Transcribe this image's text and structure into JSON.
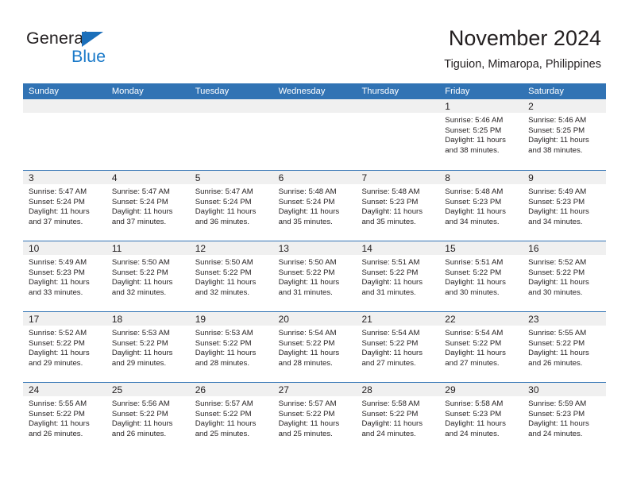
{
  "brand": {
    "name_part1": "General",
    "name_part2": "Blue",
    "triangle_color": "#1b6fba",
    "blue_color": "#1b7ac9",
    "dark_color": "#231f20"
  },
  "header": {
    "title": "November 2024",
    "subtitle": "Tiguion, Mimaropa, Philippines",
    "accent_color": "#3173b4",
    "band_color": "#f0f0f0"
  },
  "weekdays": [
    "Sunday",
    "Monday",
    "Tuesday",
    "Wednesday",
    "Thursday",
    "Friday",
    "Saturday"
  ],
  "weeks": [
    [
      {
        "day": "",
        "sunrise": "",
        "sunset": "",
        "daylight1": "",
        "daylight2": "",
        "empty": true
      },
      {
        "day": "",
        "sunrise": "",
        "sunset": "",
        "daylight1": "",
        "daylight2": "",
        "empty": true
      },
      {
        "day": "",
        "sunrise": "",
        "sunset": "",
        "daylight1": "",
        "daylight2": "",
        "empty": true
      },
      {
        "day": "",
        "sunrise": "",
        "sunset": "",
        "daylight1": "",
        "daylight2": "",
        "empty": true
      },
      {
        "day": "",
        "sunrise": "",
        "sunset": "",
        "daylight1": "",
        "daylight2": "",
        "empty": true
      },
      {
        "day": "1",
        "sunrise": "Sunrise: 5:46 AM",
        "sunset": "Sunset: 5:25 PM",
        "daylight1": "Daylight: 11 hours",
        "daylight2": "and 38 minutes.",
        "empty": false
      },
      {
        "day": "2",
        "sunrise": "Sunrise: 5:46 AM",
        "sunset": "Sunset: 5:25 PM",
        "daylight1": "Daylight: 11 hours",
        "daylight2": "and 38 minutes.",
        "empty": false
      }
    ],
    [
      {
        "day": "3",
        "sunrise": "Sunrise: 5:47 AM",
        "sunset": "Sunset: 5:24 PM",
        "daylight1": "Daylight: 11 hours",
        "daylight2": "and 37 minutes.",
        "empty": false
      },
      {
        "day": "4",
        "sunrise": "Sunrise: 5:47 AM",
        "sunset": "Sunset: 5:24 PM",
        "daylight1": "Daylight: 11 hours",
        "daylight2": "and 37 minutes.",
        "empty": false
      },
      {
        "day": "5",
        "sunrise": "Sunrise: 5:47 AM",
        "sunset": "Sunset: 5:24 PM",
        "daylight1": "Daylight: 11 hours",
        "daylight2": "and 36 minutes.",
        "empty": false
      },
      {
        "day": "6",
        "sunrise": "Sunrise: 5:48 AM",
        "sunset": "Sunset: 5:24 PM",
        "daylight1": "Daylight: 11 hours",
        "daylight2": "and 35 minutes.",
        "empty": false
      },
      {
        "day": "7",
        "sunrise": "Sunrise: 5:48 AM",
        "sunset": "Sunset: 5:23 PM",
        "daylight1": "Daylight: 11 hours",
        "daylight2": "and 35 minutes.",
        "empty": false
      },
      {
        "day": "8",
        "sunrise": "Sunrise: 5:48 AM",
        "sunset": "Sunset: 5:23 PM",
        "daylight1": "Daylight: 11 hours",
        "daylight2": "and 34 minutes.",
        "empty": false
      },
      {
        "day": "9",
        "sunrise": "Sunrise: 5:49 AM",
        "sunset": "Sunset: 5:23 PM",
        "daylight1": "Daylight: 11 hours",
        "daylight2": "and 34 minutes.",
        "empty": false
      }
    ],
    [
      {
        "day": "10",
        "sunrise": "Sunrise: 5:49 AM",
        "sunset": "Sunset: 5:23 PM",
        "daylight1": "Daylight: 11 hours",
        "daylight2": "and 33 minutes.",
        "empty": false
      },
      {
        "day": "11",
        "sunrise": "Sunrise: 5:50 AM",
        "sunset": "Sunset: 5:22 PM",
        "daylight1": "Daylight: 11 hours",
        "daylight2": "and 32 minutes.",
        "empty": false
      },
      {
        "day": "12",
        "sunrise": "Sunrise: 5:50 AM",
        "sunset": "Sunset: 5:22 PM",
        "daylight1": "Daylight: 11 hours",
        "daylight2": "and 32 minutes.",
        "empty": false
      },
      {
        "day": "13",
        "sunrise": "Sunrise: 5:50 AM",
        "sunset": "Sunset: 5:22 PM",
        "daylight1": "Daylight: 11 hours",
        "daylight2": "and 31 minutes.",
        "empty": false
      },
      {
        "day": "14",
        "sunrise": "Sunrise: 5:51 AM",
        "sunset": "Sunset: 5:22 PM",
        "daylight1": "Daylight: 11 hours",
        "daylight2": "and 31 minutes.",
        "empty": false
      },
      {
        "day": "15",
        "sunrise": "Sunrise: 5:51 AM",
        "sunset": "Sunset: 5:22 PM",
        "daylight1": "Daylight: 11 hours",
        "daylight2": "and 30 minutes.",
        "empty": false
      },
      {
        "day": "16",
        "sunrise": "Sunrise: 5:52 AM",
        "sunset": "Sunset: 5:22 PM",
        "daylight1": "Daylight: 11 hours",
        "daylight2": "and 30 minutes.",
        "empty": false
      }
    ],
    [
      {
        "day": "17",
        "sunrise": "Sunrise: 5:52 AM",
        "sunset": "Sunset: 5:22 PM",
        "daylight1": "Daylight: 11 hours",
        "daylight2": "and 29 minutes.",
        "empty": false
      },
      {
        "day": "18",
        "sunrise": "Sunrise: 5:53 AM",
        "sunset": "Sunset: 5:22 PM",
        "daylight1": "Daylight: 11 hours",
        "daylight2": "and 29 minutes.",
        "empty": false
      },
      {
        "day": "19",
        "sunrise": "Sunrise: 5:53 AM",
        "sunset": "Sunset: 5:22 PM",
        "daylight1": "Daylight: 11 hours",
        "daylight2": "and 28 minutes.",
        "empty": false
      },
      {
        "day": "20",
        "sunrise": "Sunrise: 5:54 AM",
        "sunset": "Sunset: 5:22 PM",
        "daylight1": "Daylight: 11 hours",
        "daylight2": "and 28 minutes.",
        "empty": false
      },
      {
        "day": "21",
        "sunrise": "Sunrise: 5:54 AM",
        "sunset": "Sunset: 5:22 PM",
        "daylight1": "Daylight: 11 hours",
        "daylight2": "and 27 minutes.",
        "empty": false
      },
      {
        "day": "22",
        "sunrise": "Sunrise: 5:54 AM",
        "sunset": "Sunset: 5:22 PM",
        "daylight1": "Daylight: 11 hours",
        "daylight2": "and 27 minutes.",
        "empty": false
      },
      {
        "day": "23",
        "sunrise": "Sunrise: 5:55 AM",
        "sunset": "Sunset: 5:22 PM",
        "daylight1": "Daylight: 11 hours",
        "daylight2": "and 26 minutes.",
        "empty": false
      }
    ],
    [
      {
        "day": "24",
        "sunrise": "Sunrise: 5:55 AM",
        "sunset": "Sunset: 5:22 PM",
        "daylight1": "Daylight: 11 hours",
        "daylight2": "and 26 minutes.",
        "empty": false
      },
      {
        "day": "25",
        "sunrise": "Sunrise: 5:56 AM",
        "sunset": "Sunset: 5:22 PM",
        "daylight1": "Daylight: 11 hours",
        "daylight2": "and 26 minutes.",
        "empty": false
      },
      {
        "day": "26",
        "sunrise": "Sunrise: 5:57 AM",
        "sunset": "Sunset: 5:22 PM",
        "daylight1": "Daylight: 11 hours",
        "daylight2": "and 25 minutes.",
        "empty": false
      },
      {
        "day": "27",
        "sunrise": "Sunrise: 5:57 AM",
        "sunset": "Sunset: 5:22 PM",
        "daylight1": "Daylight: 11 hours",
        "daylight2": "and 25 minutes.",
        "empty": false
      },
      {
        "day": "28",
        "sunrise": "Sunrise: 5:58 AM",
        "sunset": "Sunset: 5:22 PM",
        "daylight1": "Daylight: 11 hours",
        "daylight2": "and 24 minutes.",
        "empty": false
      },
      {
        "day": "29",
        "sunrise": "Sunrise: 5:58 AM",
        "sunset": "Sunset: 5:23 PM",
        "daylight1": "Daylight: 11 hours",
        "daylight2": "and 24 minutes.",
        "empty": false
      },
      {
        "day": "30",
        "sunrise": "Sunrise: 5:59 AM",
        "sunset": "Sunset: 5:23 PM",
        "daylight1": "Daylight: 11 hours",
        "daylight2": "and 24 minutes.",
        "empty": false
      }
    ]
  ]
}
